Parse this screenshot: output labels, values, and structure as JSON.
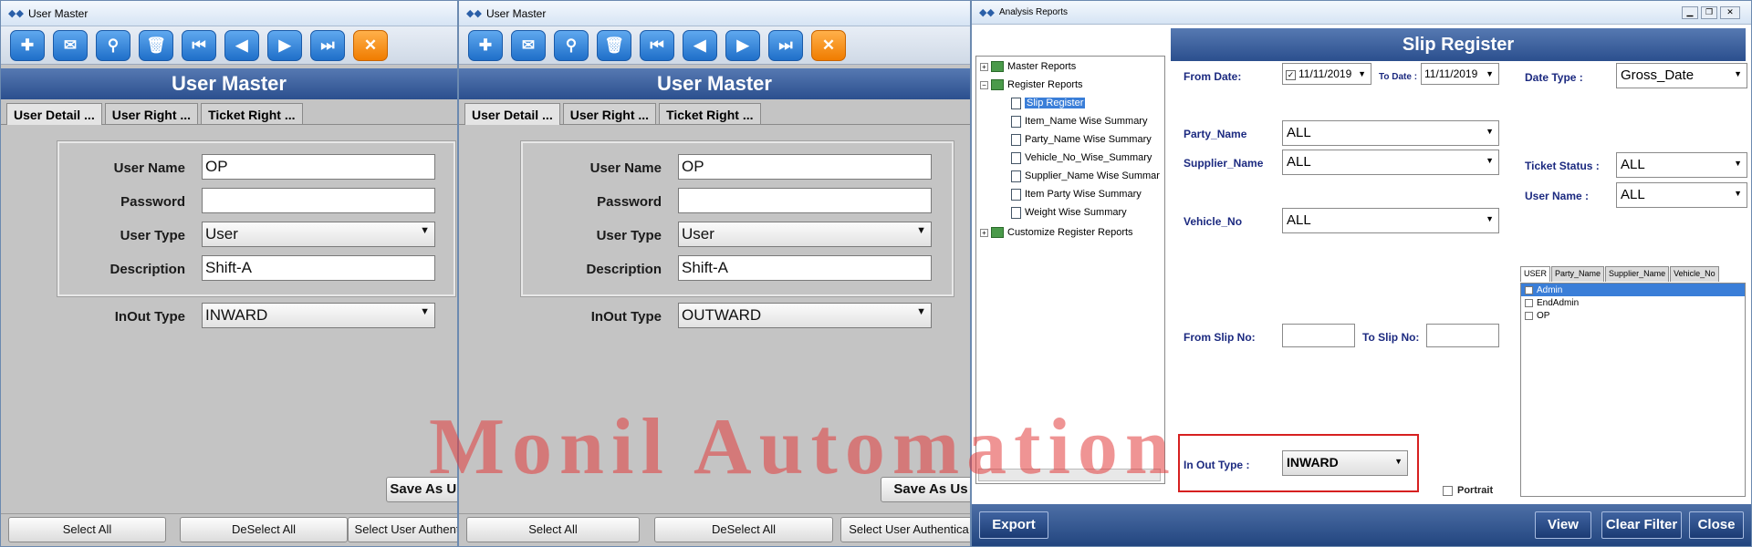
{
  "win1": {
    "title": "User Master",
    "header": "User Master",
    "tabs": [
      "User Detail ...",
      "User Right ...",
      "Ticket Right ..."
    ],
    "fields": {
      "user_name_label": "User Name",
      "user_name": "OP",
      "password_label": "Password",
      "password": "",
      "user_type_label": "User Type",
      "user_type": "User",
      "description_label": "Description",
      "description": "Shift-A",
      "inout_label": "InOut Type",
      "inout": "INWARD"
    },
    "save_label": "Save As Us",
    "select_all": "Select All",
    "deselect_all": "DeSelect All",
    "select_user_auth": "Select User Authent"
  },
  "win2": {
    "title": "User Master",
    "header": "User Master",
    "tabs": [
      "User Detail ...",
      "User Right ...",
      "Ticket Right ..."
    ],
    "fields": {
      "user_name_label": "User Name",
      "user_name": "OP",
      "password_label": "Password",
      "password": "",
      "user_type_label": "User Type",
      "user_type": "User",
      "description_label": "Description",
      "description": "Shift-A",
      "inout_label": "InOut Type",
      "inout": "OUTWARD"
    },
    "save_label": "Save As Us",
    "select_all": "Select All",
    "deselect_all": "DeSelect All",
    "select_user_auth": "Select User Authentica"
  },
  "toolbar_icons": [
    "add-icon",
    "mail-icon",
    "search-icon",
    "delete-icon",
    "first-icon",
    "previous-icon",
    "next-icon",
    "last-icon",
    "close-icon"
  ],
  "analysis": {
    "title": "Analysis Reports",
    "header": "Slip Register",
    "tree": {
      "master": "Master Reports",
      "register": "Register Reports",
      "children": [
        "Slip Register",
        "Item_Name Wise Summary",
        "Party_Name Wise Summary",
        "Vehicle_No_Wise_Summary",
        "Supplier_Name Wise Summar",
        "Item Party Wise Summary",
        "Weight Wise Summary"
      ],
      "custom": "Customize Register Reports"
    },
    "from_date_label": "From Date:",
    "from_date": "11/11/2019",
    "to_date_label": "To Date :",
    "to_date": "11/11/2019",
    "date_type_label": "Date Type :",
    "date_type": "Gross_Date",
    "party_label": "Party_Name",
    "party": "ALL",
    "supplier_label": "Supplier_Name",
    "supplier": "ALL",
    "ticket_status_label": "Ticket Status :",
    "ticket_status": "ALL",
    "user_name_label": "User Name :",
    "user_name": "ALL",
    "vehicle_label": "Vehicle_No",
    "vehicle": "ALL",
    "user_tabs": [
      "USER",
      "Party_Name",
      "Supplier_Name",
      "Vehicle_No"
    ],
    "users": [
      "Admin",
      "EndAdmin",
      "OP"
    ],
    "from_slip_label": "From Slip No:",
    "to_slip_label": "To Slip No:",
    "inout_label": "In Out Type :",
    "inout": "INWARD",
    "portrait_label": "Portrait",
    "export": "Export",
    "view": "View",
    "clear": "Clear Filter",
    "close": "Close"
  },
  "watermark": "Monil Automation"
}
